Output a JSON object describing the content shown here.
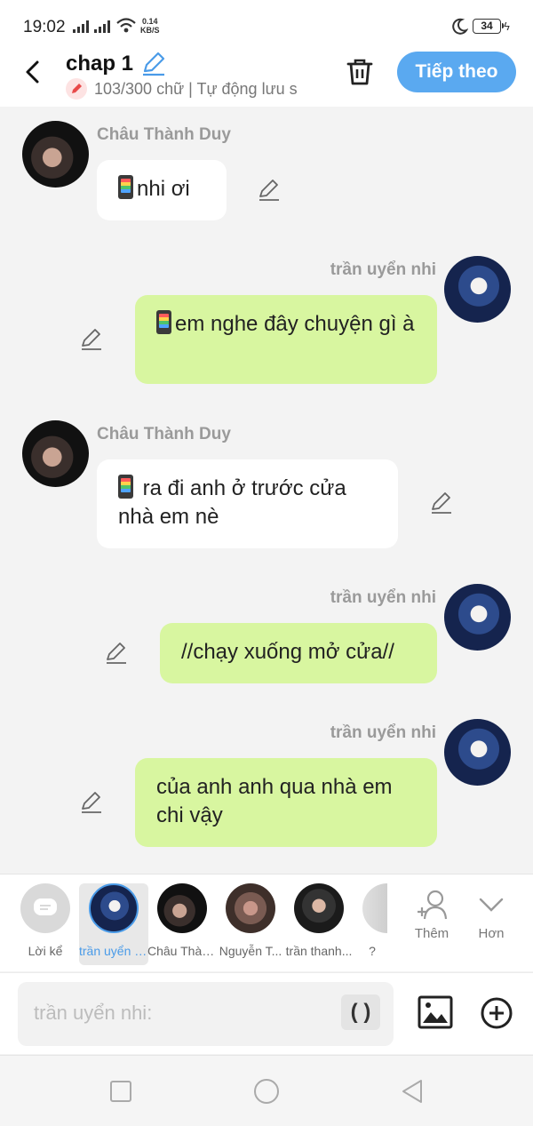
{
  "status": {
    "time": "19:02",
    "net_speed_value": "0.14",
    "net_speed_unit": "KB/S",
    "battery": "34"
  },
  "header": {
    "title": "chap 1",
    "subtitle": "103/300 chữ | Tự động lưu s",
    "next_label": "Tiếp theo"
  },
  "messages": [
    {
      "side": "left",
      "name": "Châu Thành Duy",
      "text": "nhi ơi",
      "phone": true
    },
    {
      "side": "right",
      "name": "trần uyển nhi",
      "text": "em nghe đây chuyện gì à",
      "phone": true
    },
    {
      "side": "left",
      "name": "Châu Thành Duy",
      "text": " ra đi anh ở trước cửa nhà em nè",
      "phone": true
    },
    {
      "side": "right",
      "name": "trần uyển nhi",
      "text": "//chạy xuống mở cửa//",
      "phone": false
    },
    {
      "side": "right",
      "name": "trần uyển nhi",
      "text": "của anh anh qua nhà em chi vậy",
      "phone": false
    }
  ],
  "characters": [
    {
      "label": "Lời kể",
      "icon": "narrator-icon"
    },
    {
      "label": "trần uyển nhi",
      "selected": true
    },
    {
      "label": "Châu Thành Duy"
    },
    {
      "label": "Nguyễn T..."
    },
    {
      "label": "trần thanh..."
    },
    {
      "label": "?"
    }
  ],
  "tools": {
    "add_label": "Thêm",
    "more_label": "Hơn"
  },
  "input": {
    "placeholder": "trần uyển nhi:",
    "paren_label": "( )"
  },
  "colors": {
    "accent": "#5aa9f0",
    "right_bubble": "#d8f6a0",
    "left_bubble": "#ffffff",
    "name_gray": "#9a9a9a"
  }
}
